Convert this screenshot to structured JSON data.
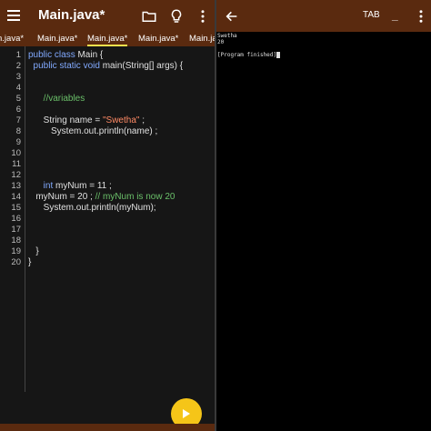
{
  "editor": {
    "title": "Main.java*",
    "tabs": [
      "n.java*",
      "Main.java*",
      "Main.java*",
      "Main.java*",
      "Main.java*"
    ],
    "active_tab_index": 2,
    "line_numbers": [
      "1",
      "2",
      "3",
      "4",
      "5",
      "6",
      "7",
      "8",
      "9",
      "10",
      "11",
      "12",
      "13",
      "14",
      "15",
      "16",
      "17",
      "18",
      "19",
      "20"
    ],
    "code": {
      "l1": [
        {
          "t": "public class ",
          "c": "kw"
        },
        {
          "t": "Main ",
          "c": "tx"
        },
        {
          "t": "{",
          "c": "tx"
        }
      ],
      "l2": [
        {
          "t": "  public static void ",
          "c": "kw"
        },
        {
          "t": "main(String[] args) {",
          "c": "tx"
        }
      ],
      "l5": [
        {
          "t": "      //variables",
          "c": "cm"
        }
      ],
      "l7": [
        {
          "t": "      String name = ",
          "c": "tx"
        },
        {
          "t": "\"Swetha\"",
          "c": "str"
        },
        {
          "t": " ;",
          "c": "tx"
        }
      ],
      "l8": [
        {
          "t": "         System.out.println(name) ;",
          "c": "tx"
        }
      ],
      "l13": [
        {
          "t": "      ",
          "c": "tx"
        },
        {
          "t": "int ",
          "c": "kw"
        },
        {
          "t": "myNum = 11 ;",
          "c": "tx"
        }
      ],
      "l14": [
        {
          "t": "   myNum = 20 ; ",
          "c": "tx"
        },
        {
          "t": "// myNum is now 20",
          "c": "cm"
        }
      ],
      "l15": [
        {
          "t": "      System.out.println(myNum);",
          "c": "tx"
        }
      ],
      "l19": [
        {
          "t": "   }",
          "c": "tx"
        }
      ],
      "l20": [
        {
          "t": "}",
          "c": "tx"
        }
      ]
    }
  },
  "console": {
    "output_lines": [
      "Swetha",
      "20",
      "",
      "[Program finished]"
    ],
    "tab_key_label": "TAB",
    "underscore_key_label": "_"
  },
  "colors": {
    "toolbar": "#5a2a0f",
    "accent": "#ffe14d",
    "fab": "#f5c518",
    "keyword": "#82aaff",
    "string": "#ff8a65",
    "comment": "#6abf69"
  },
  "icons": {
    "menu": "hamburger-icon",
    "folder": "folder-icon",
    "bulb": "lightbulb-icon",
    "more": "more-vert-icon",
    "back": "arrow-back-icon",
    "run": "play-icon"
  }
}
